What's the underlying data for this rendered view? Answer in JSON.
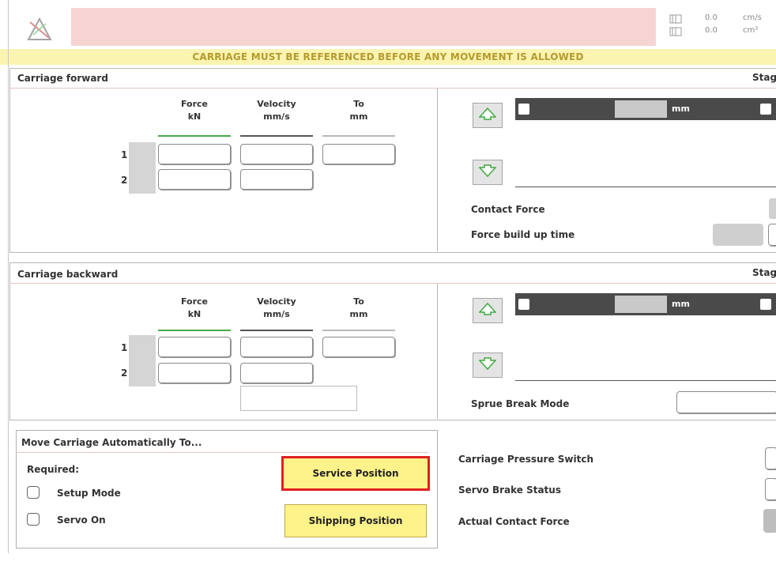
{
  "header": {
    "logo_icon": "warning-triangle-icon",
    "indicators": [
      {
        "icon": "velocity-gauge-icon",
        "value": "0.0",
        "unit": "cm/s"
      },
      {
        "icon": "volume-gauge-icon",
        "value": "0.0",
        "unit": "cm³"
      }
    ],
    "warning": "CARRIAGE MUST BE REFERENCED BEFORE ANY MOVEMENT IS ALLOWED"
  },
  "forward": {
    "title": "Carriage forward",
    "stage_label": "Stag",
    "col_force": "Force",
    "col_force_unit": "kN",
    "col_velocity": "Velocity",
    "col_velocity_unit": "mm/s",
    "col_to": "To",
    "col_to_unit": "mm",
    "rows": [
      "1",
      "2"
    ],
    "position_unit": "mm",
    "contact_force_label": "Contact Force",
    "force_build_label": "Force build up time"
  },
  "backward": {
    "title": "Carriage backward",
    "stage_label": "Stag",
    "col_force": "Force",
    "col_force_unit": "kN",
    "col_velocity": "Velocity",
    "col_velocity_unit": "mm/s",
    "col_to": "To",
    "col_to_unit": "mm",
    "rows": [
      "1",
      "2"
    ],
    "position_unit": "mm",
    "sprue_label": "Sprue Break Mode"
  },
  "auto_move": {
    "title": "Move Carriage Automatically To...",
    "required_label": "Required:",
    "setup_mode_label": "Setup Mode",
    "servo_on_label": "Servo On",
    "service_button": "Service Position",
    "shipping_button": "Shipping Position"
  },
  "status": {
    "pressure_switch_label": "Carriage Pressure Switch",
    "servo_brake_label": "Servo Brake Status",
    "actual_contact_label": "Actual Contact Force"
  },
  "colors": {
    "alarm_band": "#f7d4d4",
    "warning_bg": "#fbf3b0",
    "button_yellow": "#fef28a",
    "highlight_red": "#e02020",
    "arrow_green": "#3faa3f"
  }
}
